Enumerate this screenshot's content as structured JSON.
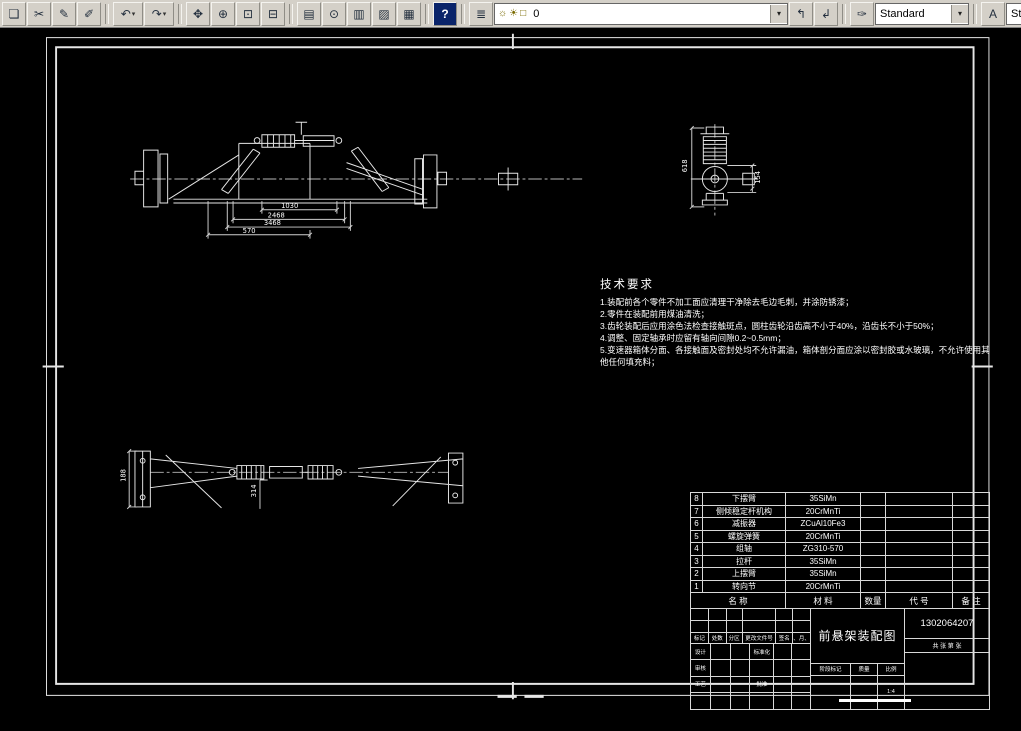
{
  "toolbar": {
    "arrow": "▾",
    "buttons": [
      {
        "name": "new-sheet-button",
        "glyph": "❏"
      },
      {
        "name": "cut-button",
        "glyph": "✂"
      },
      {
        "name": "pencil-button",
        "glyph": "✎"
      },
      {
        "name": "pencil-edit-button",
        "glyph": "✐"
      },
      {
        "name": "undo-button",
        "glyph": "↶"
      },
      {
        "name": "redo-button",
        "glyph": "↷"
      },
      {
        "name": "pan-button",
        "glyph": "✥"
      },
      {
        "name": "zoom-realtime-button",
        "glyph": "⊕"
      },
      {
        "name": "zoom-window-button",
        "glyph": "⊡"
      },
      {
        "name": "zoom-previous-button",
        "glyph": "⊟"
      },
      {
        "name": "named-views-button",
        "glyph": "▤"
      },
      {
        "name": "orbit-button",
        "glyph": "⊙"
      },
      {
        "name": "render-button",
        "glyph": "▥"
      },
      {
        "name": "region-button",
        "glyph": "▨"
      },
      {
        "name": "table-button",
        "glyph": "▦"
      },
      {
        "name": "help-button",
        "glyph": "?"
      },
      {
        "name": "layers-button",
        "glyph": "≣"
      },
      {
        "name": "make-layer-current-button",
        "glyph": "↰"
      },
      {
        "name": "layer-previous-button",
        "glyph": "↲"
      },
      {
        "name": "properties-button",
        "glyph": "✑"
      },
      {
        "name": "text-style-button",
        "glyph": "A"
      }
    ],
    "layer_combo": {
      "icons": [
        "☼",
        "☀",
        "□"
      ],
      "value": "0"
    },
    "style_combo": {
      "value": "Standard"
    },
    "text_style_combo": {
      "value": "Sta"
    }
  },
  "drawing": {
    "tech": {
      "title": "技术要求",
      "items": [
        "1.装配前各个零件不加工面应清理干净除去毛边毛刺，并涂防锈漆；",
        "2.零件在装配前用煤油清洗；",
        "3.齿轮装配后应用涂色法检查接触斑点，圆柱齿轮沿齿高不小于40%，沿齿长不小于50%；",
        "4.调整、固定轴承时应留有轴向间隙0.2~0.5mm；",
        "5.变速器箱体分面、各接触面及密封处均不允许漏油，箱体剖分面应涂以密封胶或水玻璃，不允许使用其他任何填充料；"
      ]
    },
    "dims": {
      "d1": "1030",
      "d2": "2468",
      "d3": "3468",
      "d4": "570",
      "d5": "618",
      "d6": "154",
      "d7": "188",
      "d8": "314"
    },
    "parts": {
      "headers": {
        "name": "名  称",
        "material": "材  料",
        "qty": "数量",
        "code": "代  号",
        "note": "备  注"
      },
      "rows": [
        {
          "no": "8",
          "name": "下摆臂",
          "material": "35SiMn",
          "qty": "",
          "code": "",
          "note": ""
        },
        {
          "no": "7",
          "name": "侧倾稳定杆机构",
          "material": "20CrMnTi",
          "qty": "",
          "code": "",
          "note": ""
        },
        {
          "no": "6",
          "name": "减振器",
          "material": "ZCuAl10Fe3",
          "qty": "",
          "code": "",
          "note": ""
        },
        {
          "no": "5",
          "name": "螺旋弹簧",
          "material": "20CrMnTi",
          "qty": "",
          "code": "",
          "note": ""
        },
        {
          "no": "4",
          "name": "组轴",
          "material": "ZG310-570",
          "qty": "",
          "code": "",
          "note": ""
        },
        {
          "no": "3",
          "name": "拉杆",
          "material": "35SiMn",
          "qty": "",
          "code": "",
          "note": ""
        },
        {
          "no": "2",
          "name": "上摆臂",
          "material": "35SiMn",
          "qty": "",
          "code": "",
          "note": ""
        },
        {
          "no": "1",
          "name": "转向节",
          "material": "20CrMnTi",
          "qty": "",
          "code": "",
          "note": ""
        }
      ]
    },
    "titleblock": {
      "title": "前悬架装配图",
      "number": "1302064207",
      "scale": "1:4",
      "stage_label": "阶段标记",
      "weight_label": "质量",
      "scale_label": "比例",
      "sheets": "共 张 第 张",
      "rev_labels": {
        "mark": "标记",
        "count": "处数",
        "zone": "分区",
        "doc": "更改文件号",
        "sign": "签名",
        "date": "年、月、日"
      },
      "sig_labels": {
        "design": "设计",
        "check": "审核",
        "process": "工艺",
        "standard": "标准化",
        "approve": "批准"
      }
    }
  }
}
